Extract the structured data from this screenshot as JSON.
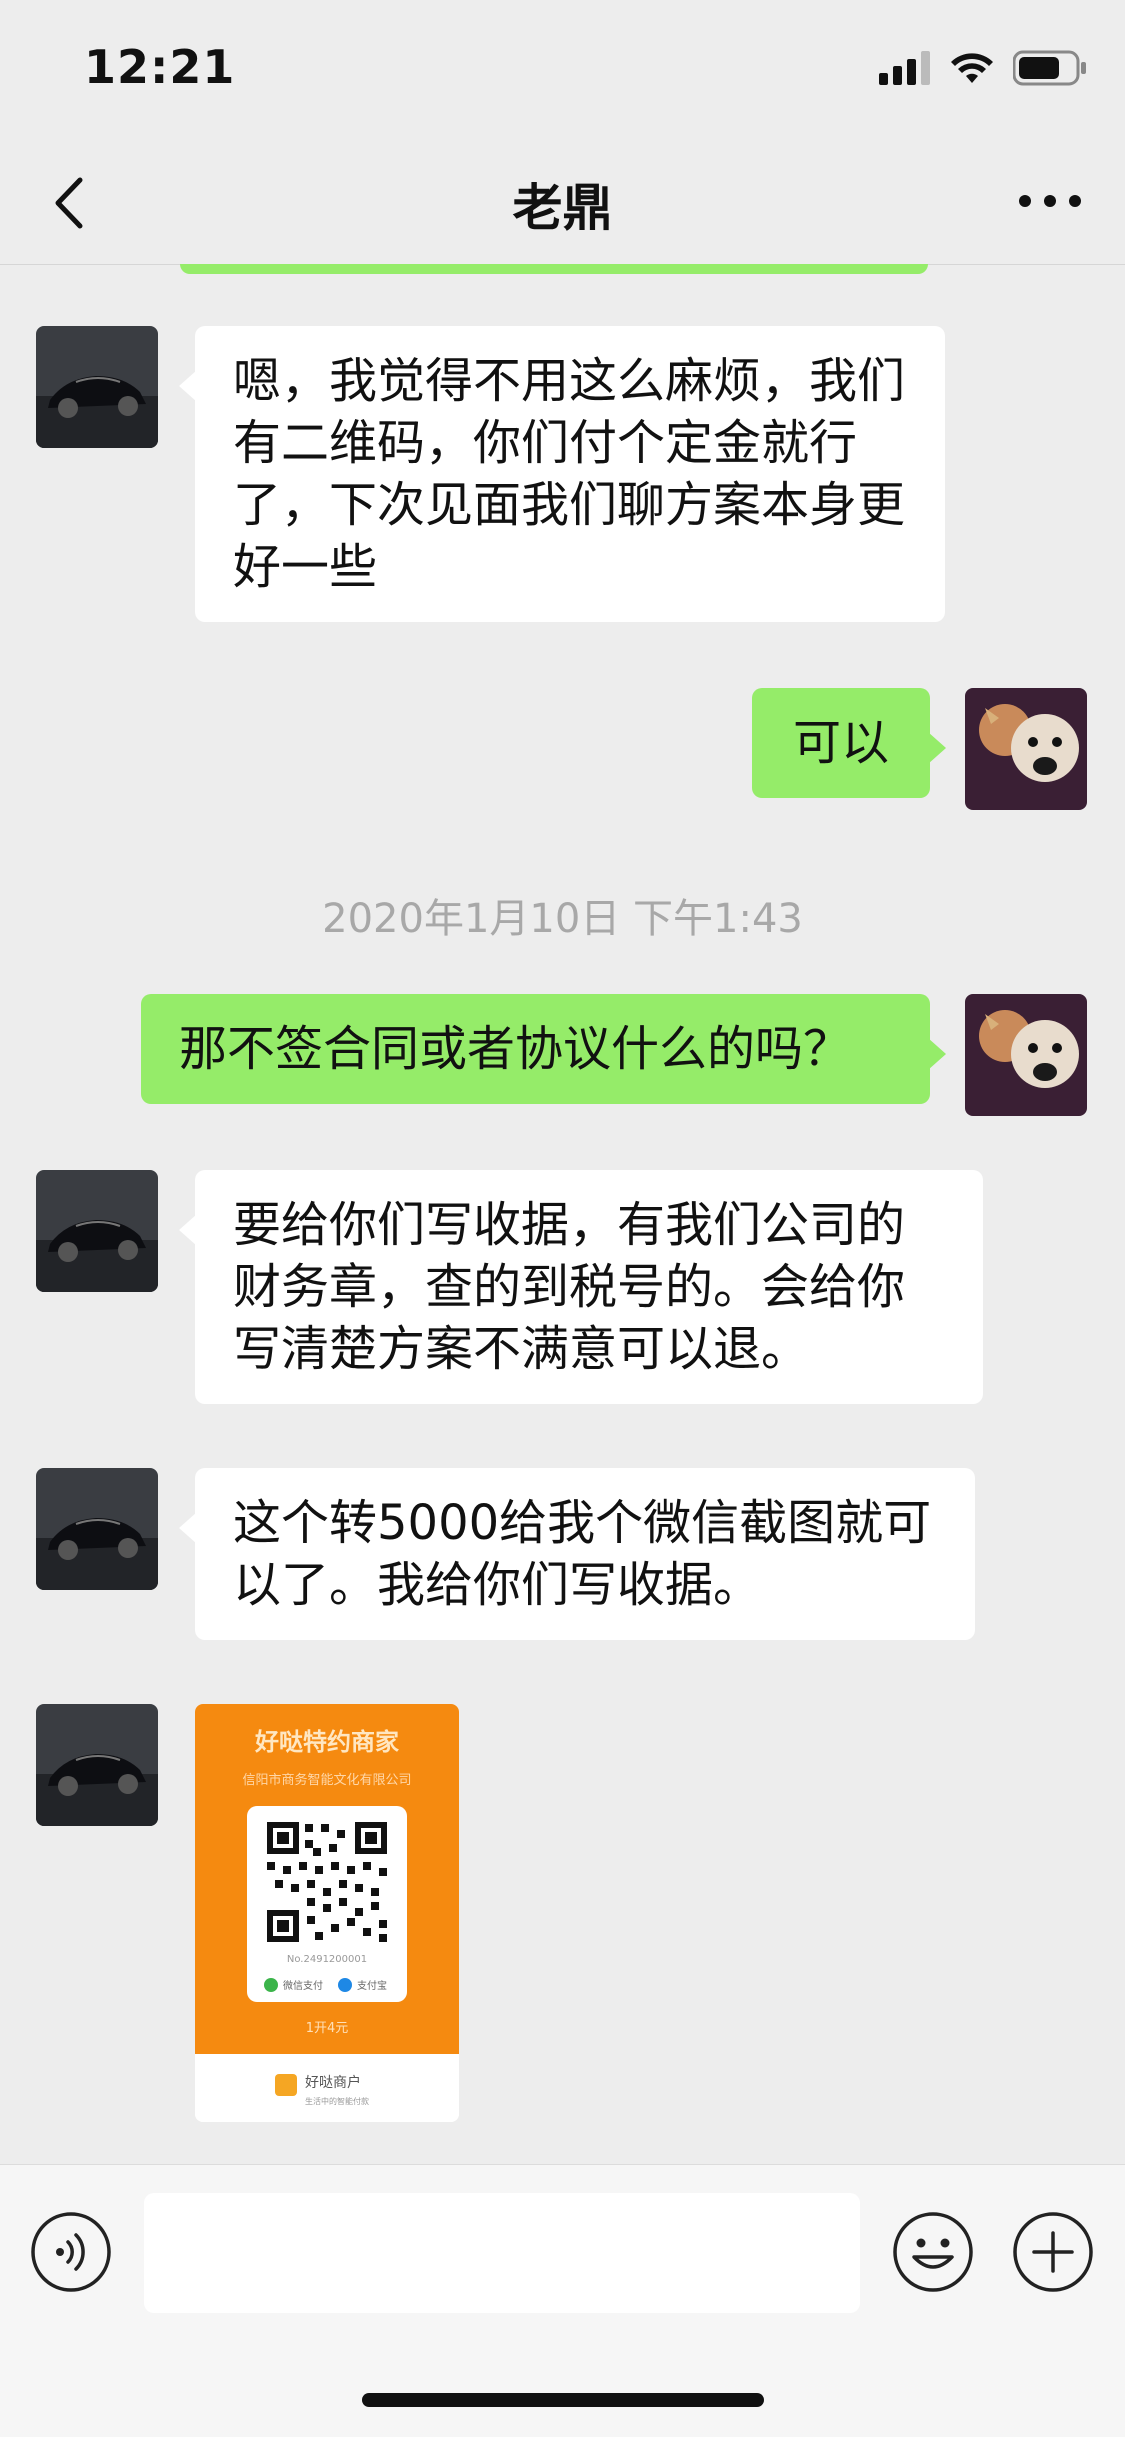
{
  "status_bar": {
    "time": "12:21"
  },
  "header": {
    "title": "老鼎"
  },
  "messages": [
    {
      "side": "in",
      "text": "嗯，我觉得不用这么麻烦，我们有二维码，你们付个定金就行了，下次见面我们聊方案本身更好一些"
    },
    {
      "side": "out",
      "text": "可以"
    },
    {
      "type": "timestamp",
      "text": "2020年1月10日 下午1:43"
    },
    {
      "side": "out",
      "text": "那不签合同或者协议什么的吗？"
    },
    {
      "side": "in",
      "text": "要给你们写收据，有我们公司的财务章，查的到税号的。会给你写清楚方案不满意可以退。"
    },
    {
      "side": "in",
      "text": "这个转5000给我个微信截图就可以了。我给你们写收据。"
    },
    {
      "side": "in",
      "type": "image",
      "image": {
        "title": "好哒特约商家",
        "subtitle": "信阳市商务智能文化有限公司",
        "qr_caption": "No.2491200001",
        "pay_wechat": "微信支付",
        "pay_alipay": "支付宝",
        "bottom_text": "1开4元",
        "brand": "好哒商户",
        "brand_sub": "生活中的智能付款"
      }
    }
  ],
  "colors": {
    "outgoing_bubble": "#95ec69",
    "incoming_bubble": "#ffffff",
    "background": "#ededed"
  },
  "icons": [
    "back-icon",
    "more-icon",
    "voice-icon",
    "emoji-icon",
    "plus-icon"
  ]
}
